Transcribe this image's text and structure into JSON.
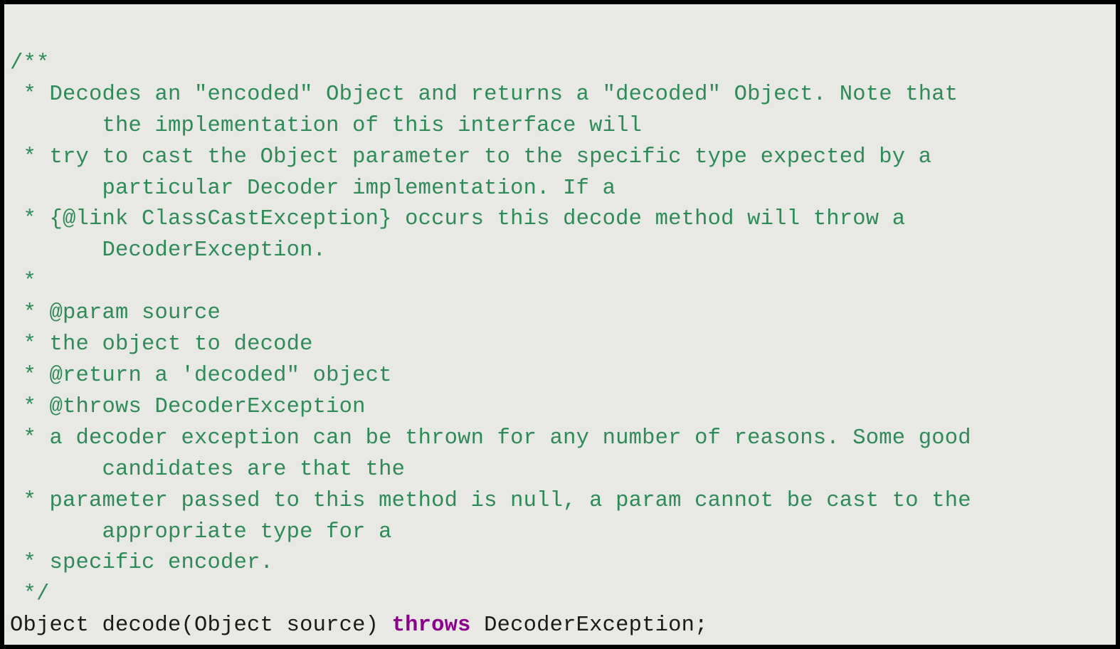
{
  "code": {
    "comment_open": "/**",
    "line1a": " * Decodes an \"encoded\" Object and returns a \"decoded\" Object. Note that",
    "line1b": "       the implementation of this interface will",
    "line2a": " * try to cast the Object parameter to the specific type expected by a",
    "line2b": "       particular Decoder implementation. If a",
    "line3a": " * {@link ClassCastException} occurs this decode method will throw a",
    "line3b": "       DecoderException.",
    "line4": " *",
    "line5": " * @param source",
    "line6": " * the object to decode",
    "line7": " * @return a 'decoded\" object",
    "line8": " * @throws DecoderException",
    "line9a": " * a decoder exception can be thrown for any number of reasons. Some good",
    "line9b": "       candidates are that the",
    "line10a": " * parameter passed to this method is null, a param cannot be cast to the",
    "line10b": "       appropriate type for a",
    "line11": " * specific encoder.",
    "comment_close": " */",
    "sig_pre": "Object decode(Object source) ",
    "sig_kw": "throws",
    "sig_post": " DecoderException;"
  },
  "colors": {
    "comment": "#2e8b57",
    "keyword": "#8b008b",
    "plain": "#1a1a1a",
    "bg": "#e8e8e4",
    "border": "#000000"
  }
}
